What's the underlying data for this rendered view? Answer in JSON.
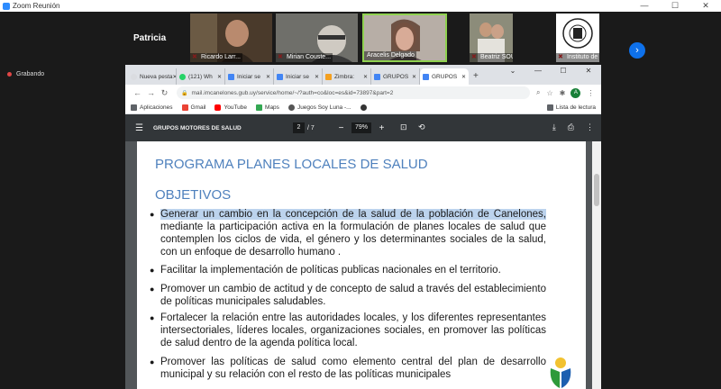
{
  "zoom": {
    "window_title": "Zoom Reunión",
    "speaker_name": "Patricia",
    "participants": [
      {
        "name": "Ricardo Larr..."
      },
      {
        "name": "Mirian Couste..."
      },
      {
        "name": "Aracelis Delgado"
      },
      {
        "name": "Beatriz SOUTO"
      },
      {
        "name": "Instituto de H..."
      }
    ],
    "recording_label": "Grabando"
  },
  "browser": {
    "tabs": [
      {
        "label": "Nueva pesta",
        "color": "#ffffff"
      },
      {
        "label": "(121) Wh",
        "color": "#25d366"
      },
      {
        "label": "Iniciar se",
        "color": "#4285f4"
      },
      {
        "label": "Iniciar se",
        "color": "#4285f4"
      },
      {
        "label": "Zimbra:",
        "color": "#f4a020"
      },
      {
        "label": "GRUPOS",
        "color": "#4285f4"
      },
      {
        "label": "GRUPOS",
        "color": "#4285f4"
      }
    ],
    "new_tab_symbol": "+",
    "url": "mail.imcanelones.gub.uy/service/home/~/?auth=co&loc=es&id=73897&part=2",
    "avatar_letter": "A",
    "bookmarks": [
      {
        "label": "Aplicaciones",
        "color": "#5f6368"
      },
      {
        "label": "Gmail",
        "color": "#ea4335"
      },
      {
        "label": "YouTube",
        "color": "#ff0000"
      },
      {
        "label": "Maps",
        "color": "#34a853"
      },
      {
        "label": "Juegos Soy Luna -...",
        "color": "#9c27b0"
      },
      {
        "label": "",
        "color": "#333333"
      }
    ],
    "reading_list": "Lista de lectura"
  },
  "pdf": {
    "title": "GRUPOS MOTORES DE SALUD",
    "current_page": "2",
    "total_pages": "/ 7",
    "zoom": "79%"
  },
  "document": {
    "heading": "PROGRAMA PLANES LOCALES DE SALUD",
    "subheading": "OBJETIVOS",
    "bullets": [
      {
        "highlighted": "Generar un cambio en la concepción de la salud de la población de Canelones,",
        "rest": "mediante la participación activa en la formulación de planes locales de salud que contemplen los ciclos de vida, el género y los determinantes sociales de la salud, con un enfoque de desarrollo humano ."
      },
      {
        "text": "Facilitar la implementación de políticas publicas nacionales en el territorio."
      },
      {
        "text": "Promover un cambio de actitud y de concepto de salud a través del establecimiento de políticas municipales saludables."
      },
      {
        "text": "Fortalecer la relación entre las autoridades locales, y los diferentes representantes intersectoriales, líderes locales, organizaciones sociales, en promover las políticas de salud dentro de la agenda política local."
      },
      {
        "text": "Promover las políticas de salud como elemento central del plan de desarrollo municipal y su relación con el resto de las políticas municipales"
      }
    ]
  }
}
